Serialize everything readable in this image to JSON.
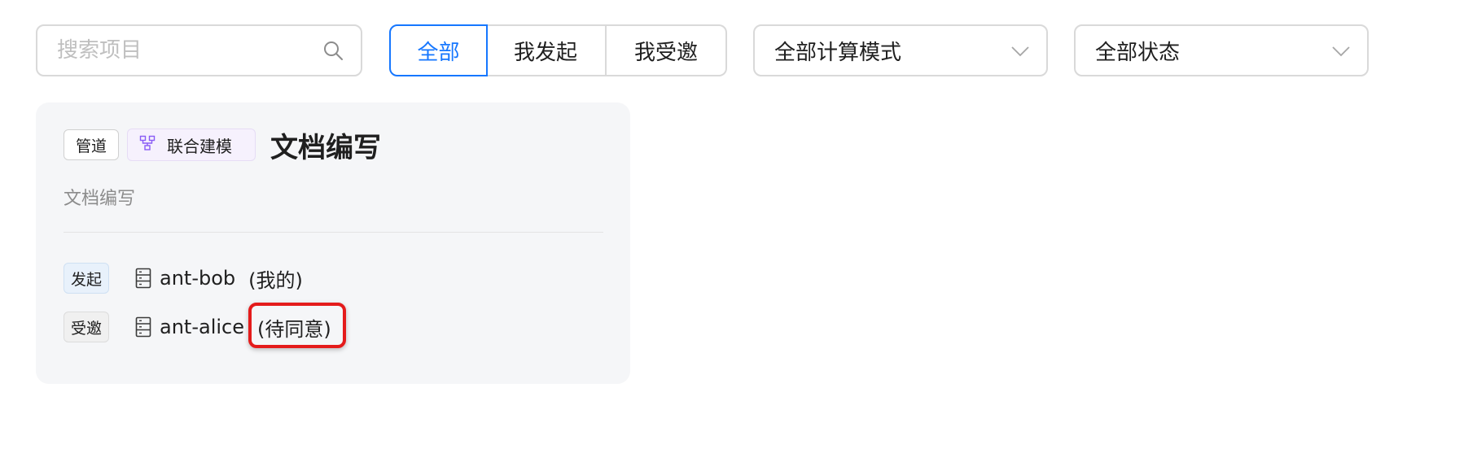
{
  "search": {
    "placeholder": "搜索项目",
    "value": ""
  },
  "filter_tabs": [
    {
      "label": "全部",
      "active": true
    },
    {
      "label": "我发起",
      "active": false
    },
    {
      "label": "我受邀",
      "active": false
    }
  ],
  "compute_mode_select": {
    "value": "全部计算模式"
  },
  "status_select": {
    "value": "全部状态"
  },
  "project_card": {
    "type_tag": "管道",
    "mode_tag": "联合建模",
    "title": "文档编写",
    "description": "文档编写",
    "participants": [
      {
        "role": "发起",
        "node": "ant-bob",
        "status": "(我的)"
      },
      {
        "role": "受邀",
        "node": "ant-alice",
        "status": "(待同意)"
      }
    ]
  },
  "colors": {
    "accent": "#1677ff",
    "border": "#d9d9d9",
    "card_bg": "#f5f6f8",
    "highlight": "#e41b1b",
    "mode_tag_icon": "#8a5cf5"
  },
  "icons": {
    "search": "search-icon",
    "dropdown": "chevron-down-icon",
    "mode": "network-topology-icon",
    "node": "server-icon"
  }
}
